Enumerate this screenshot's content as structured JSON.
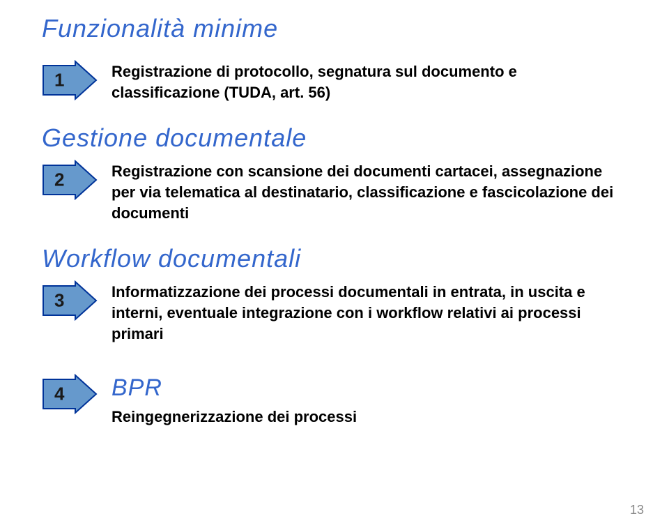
{
  "title": "Funzionalità minime",
  "page_number": "13",
  "arrows": {
    "fill": "#6699cc",
    "stroke": "#003399"
  },
  "items": [
    {
      "number": "1",
      "desc": "Registrazione di protocollo, segnatura sul documento e classificazione (TUDA, art. 56)"
    }
  ],
  "sections": [
    {
      "heading": "Gestione documentale",
      "number": "2",
      "desc": "Registrazione con scansione dei documenti cartacei, assegnazione per via telematica al destinatario, classificazione e fascicolazione dei documenti"
    },
    {
      "heading": "Workflow documentali",
      "number": "3",
      "desc": "Informatizzazione dei processi documentali in entrata, in uscita e interni, eventuale integrazione con i workflow relativi ai processi primari"
    }
  ],
  "bpr": {
    "number": "4",
    "title": "BPR",
    "desc": "Reingegnerizzazione dei processi"
  }
}
